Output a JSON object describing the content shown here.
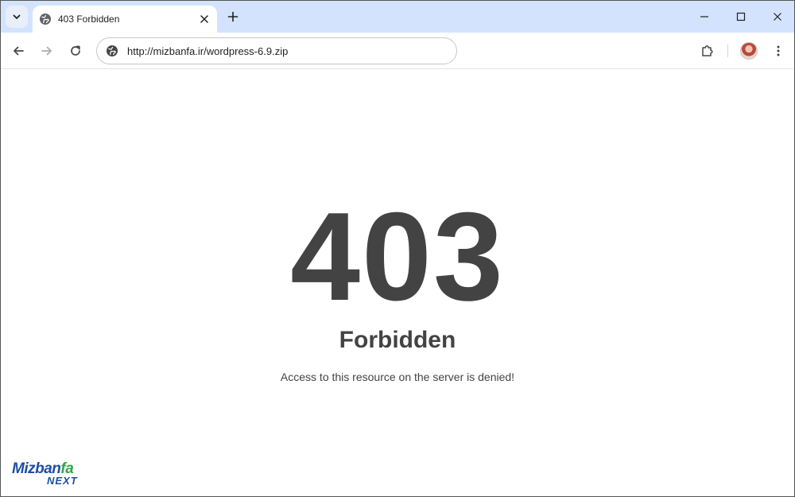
{
  "browser": {
    "tab": {
      "title": "403 Forbidden"
    },
    "address_bar": {
      "url": "http://mizbanfa.ir/wordpress-6.9.zip"
    },
    "icons": {
      "tab_search": "chevron-down-icon",
      "favicon": "globe-icon",
      "tab_close": "close-icon",
      "new_tab": "plus-icon",
      "minimize": "minimize-icon",
      "maximize": "maximize-icon",
      "close_window": "close-icon",
      "back": "arrow-left-icon",
      "forward": "arrow-right-icon",
      "reload": "reload-icon",
      "site_info": "globe-icon",
      "extensions": "puzzle-icon",
      "profile": "avatar",
      "menu": "kebab-menu-icon"
    },
    "colors": {
      "tabstrip": "#d3e3fd",
      "toolbar": "#ffffff"
    }
  },
  "page": {
    "code": "403",
    "title": "Forbidden",
    "message": "Access to this resource on the server is denied!",
    "text_color": "#434343"
  },
  "watermark": {
    "brand_main": "Mizban",
    "brand_accent": "fa",
    "brand_sub": "NEXT",
    "colors": {
      "blue": "#1d4fa3",
      "green": "#2aa84a"
    }
  }
}
